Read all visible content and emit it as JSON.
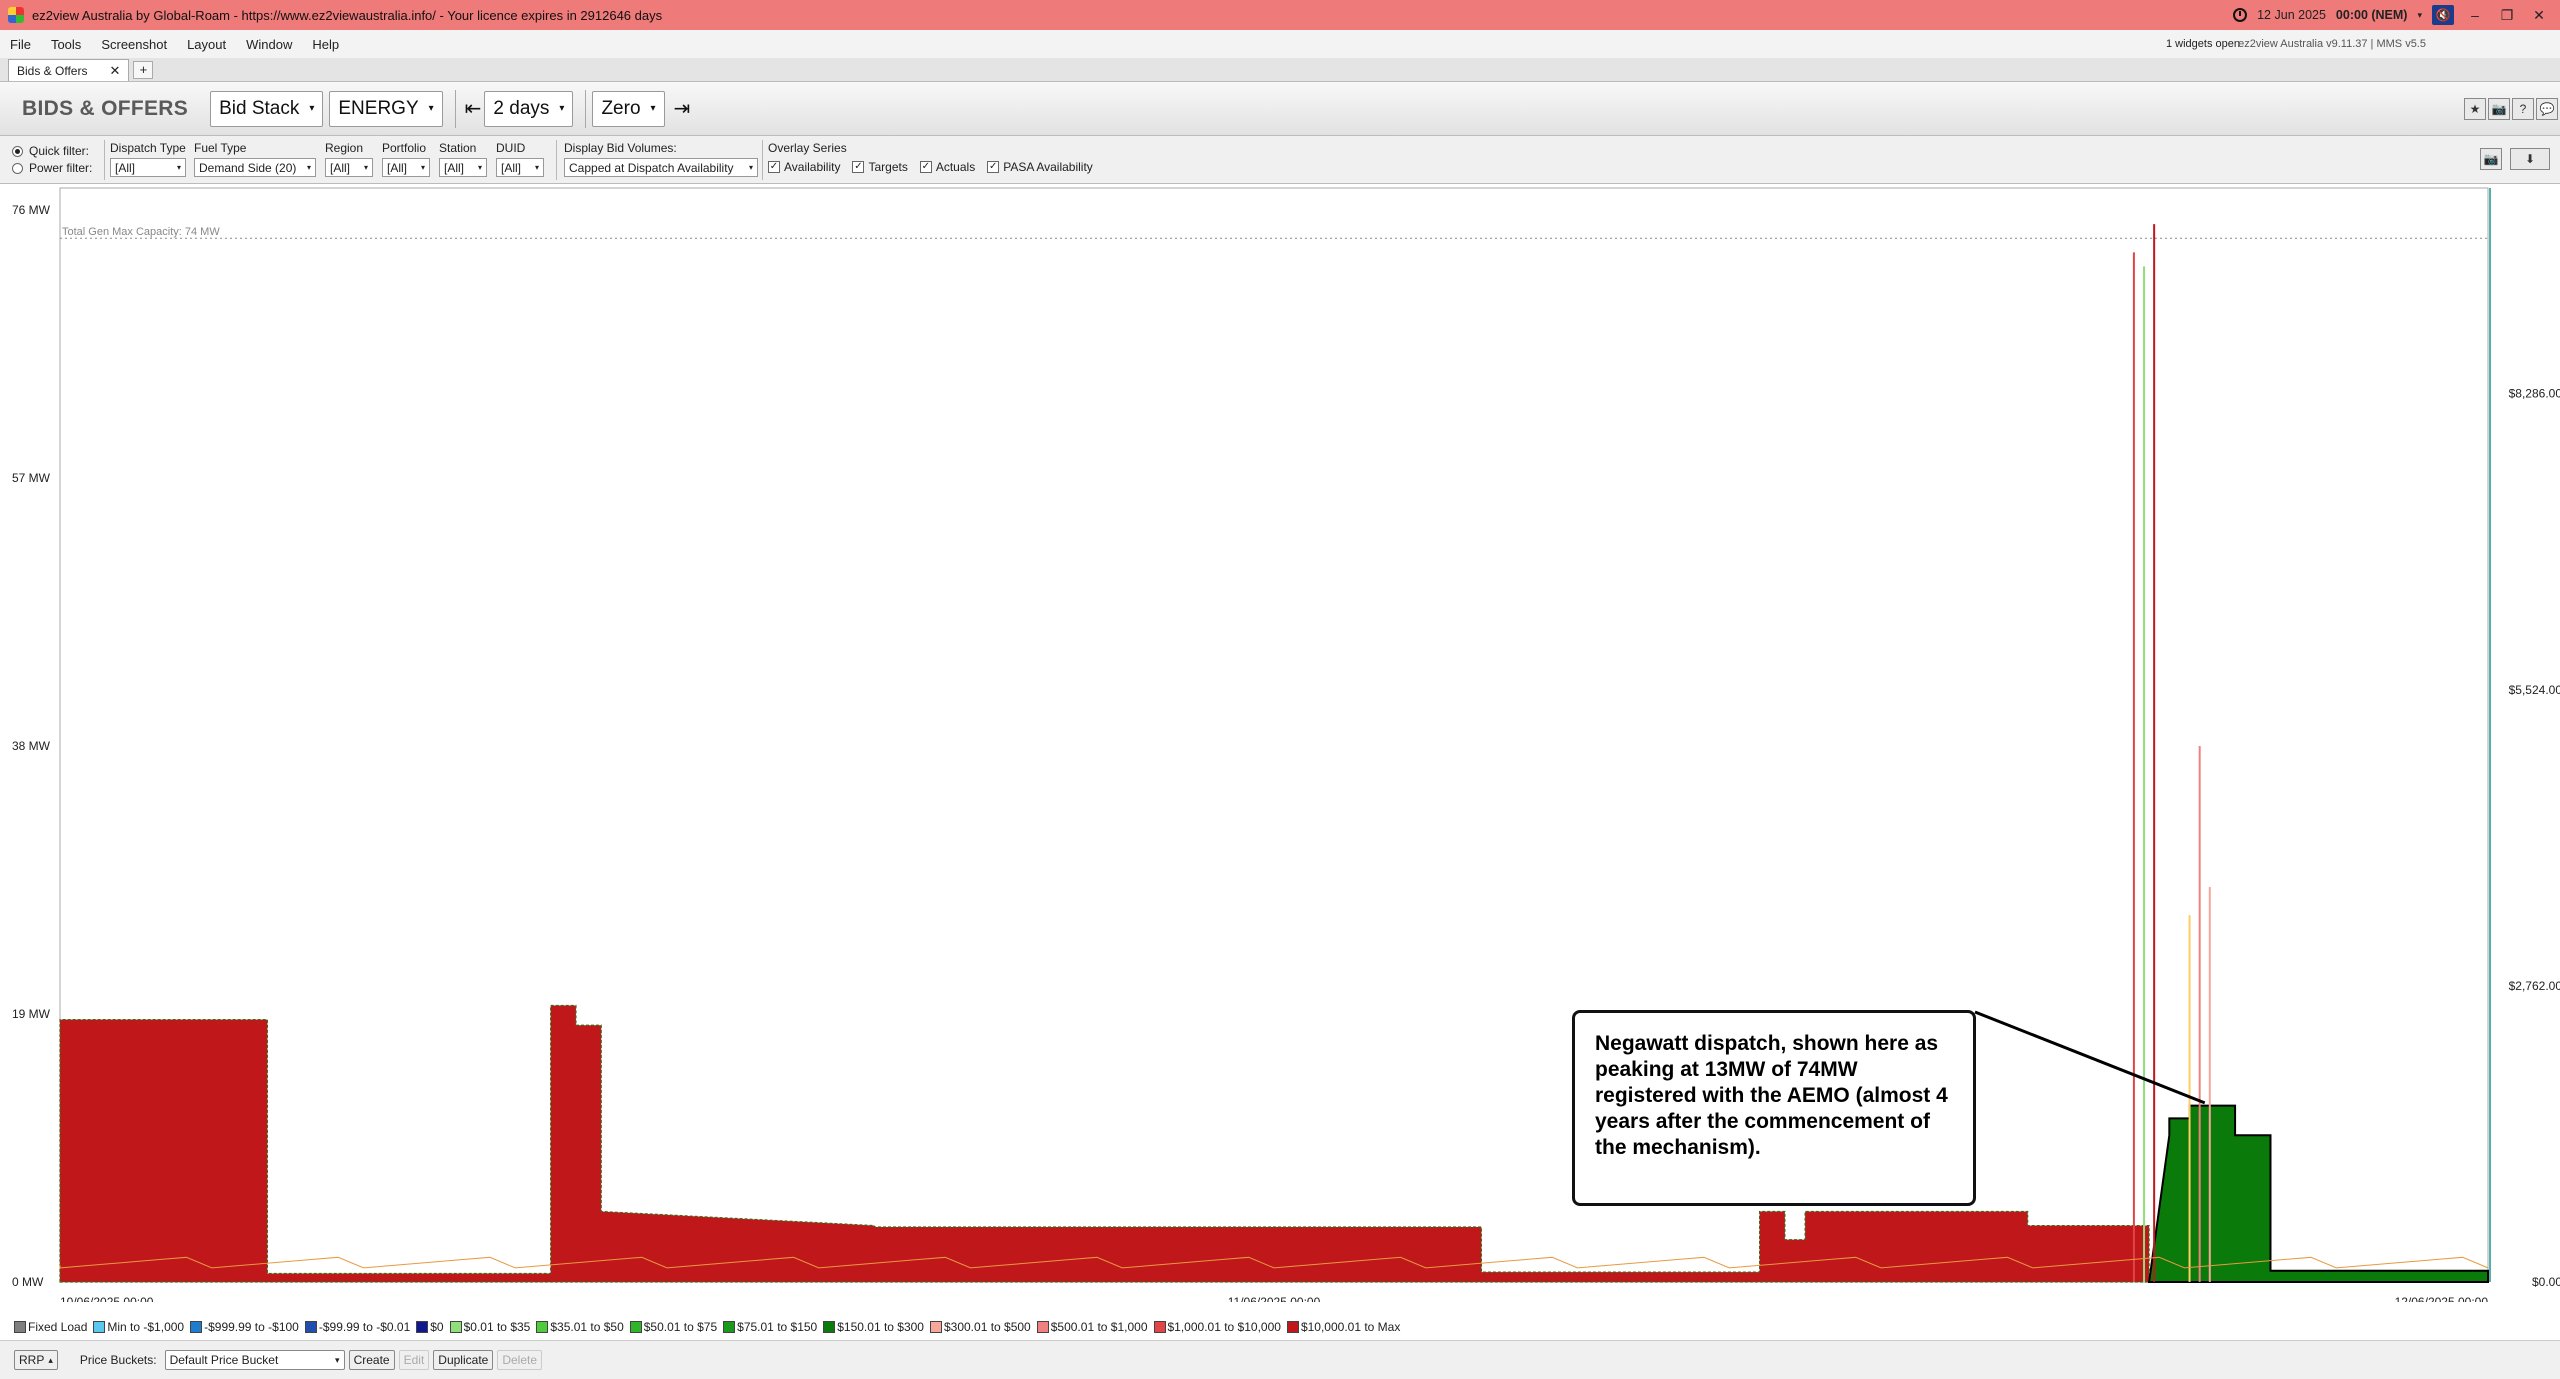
{
  "window": {
    "title": "ez2view Australia by Global-Roam - https://www.ez2viewaustralia.info/ - Your licence expires in 2912646 days",
    "clock": "12 Jun 2025",
    "clock_time": "00:00 (NEM)",
    "mute_glyph": "🔇",
    "min_glyph": "–",
    "restore_glyph": "❐",
    "close_glyph": "✕"
  },
  "menu": {
    "items": [
      "File",
      "Tools",
      "Screenshot",
      "Layout",
      "Window",
      "Help"
    ],
    "widgets_open": "1 widgets open",
    "version_info": "ez2view Australia v9.11.37 | MMS v5.5"
  },
  "tabs": [
    {
      "label": "Bids & Offers",
      "close": "✕"
    }
  ],
  "tab_add": "+",
  "toolbar": {
    "widget_title": "BIDS & OFFERS",
    "view_mode": "Bid Stack",
    "market": "ENERGY",
    "back_glyph": "⇤",
    "period": "2 days",
    "forward_glyph": "⇥",
    "baseline": "Zero",
    "arrow": "▾",
    "icons": [
      "★",
      "📷",
      "?",
      "💬"
    ]
  },
  "filters": {
    "quick_filter": "Quick filter:",
    "power_filter": "Power filter:",
    "dispatch_type": {
      "label": "Dispatch Type",
      "value": "[All]"
    },
    "fuel_type": {
      "label": "Fuel Type",
      "value": "Demand Side (20)"
    },
    "region": {
      "label": "Region",
      "value": "[All]"
    },
    "portfolio": {
      "label": "Portfolio",
      "value": "[All]"
    },
    "station": {
      "label": "Station",
      "value": "[All]"
    },
    "duid": {
      "label": "DUID",
      "value": "[All]"
    },
    "display_bid_volumes": {
      "label": "Display Bid Volumes:",
      "value": "Capped at Dispatch Availability"
    },
    "overlay_series": {
      "label": "Overlay Series",
      "items": [
        "Availability",
        "Targets",
        "Actuals",
        "PASA Availability"
      ],
      "check": "✓"
    },
    "right_icons": [
      "📷",
      "⬇"
    ]
  },
  "chart_data": {
    "type": "area",
    "title": "",
    "capacity_label": "Total Gen Max Capacity: 74 MW",
    "capacity_mw": 74,
    "ylim": [
      0,
      76
    ],
    "yticks": [
      "76 MW",
      "57 MW",
      "38 MW",
      "19 MW",
      "0 MW"
    ],
    "yticks_right": [
      "$8,286.00",
      "$5,524.00",
      "$2,762.00",
      "$0.00"
    ],
    "yticks_right_values": [
      8286,
      5524,
      2762,
      0
    ],
    "y2lim": [
      0,
      10000
    ],
    "xticks": [
      "10/06/2025 00:00",
      "11/06/2025 00:00",
      "12/06/2025 00:00"
    ],
    "x_hours": [
      0,
      48
    ],
    "series": [
      {
        "name": "$10,000.01 to Max",
        "color": "#c0171a",
        "x": [
          0,
          4.1,
          4.1,
          9.7,
          9.7,
          10.2,
          10.2,
          10.7,
          10.7,
          16.1,
          16.1,
          28.1,
          28.1,
          33.6,
          33.6,
          34.1,
          34.1,
          34.5,
          34.5,
          38.9,
          38.9,
          41.3,
          41.3
        ],
        "values": [
          18.6,
          18.6,
          0.6,
          0.6,
          19.6,
          19.6,
          18.2,
          18.2,
          5.0,
          4.0,
          3.9,
          3.9,
          0.7,
          0.7,
          5.0,
          5.0,
          3.0,
          3.0,
          5.0,
          5.0,
          4.0,
          4.0,
          0
        ]
      },
      {
        "name": "$150.01 to $300",
        "color": "#0a7a0a",
        "x": [
          41.3,
          41.7,
          41.7,
          42.1,
          42.1,
          43.0,
          43.0,
          43.7,
          43.7,
          48.0
        ],
        "values": [
          0,
          10.4,
          11.6,
          11.6,
          12.5,
          12.5,
          10.4,
          10.4,
          0.8,
          0.8
        ]
      }
    ],
    "annotation": "Negawatt dispatch, shown here as peaking at 13MW of 74MW registered with the AEMO (almost 4 years after the commencement of the mechanism)."
  },
  "legend": [
    {
      "label": "Fixed Load",
      "color": "#7f7f7f"
    },
    {
      "label": "Min to -$1,000",
      "color": "#5bc8f0"
    },
    {
      "label": "-$999.99 to -$100",
      "color": "#1f7dd0"
    },
    {
      "label": "-$99.99 to -$0.01",
      "color": "#1f4fb0"
    },
    {
      "label": "$0",
      "color": "#101890"
    },
    {
      "label": "$0.01 to $35",
      "color": "#8fe07a"
    },
    {
      "label": "$35.01 to $50",
      "color": "#4fcc3c"
    },
    {
      "label": "$50.01 to $75",
      "color": "#2fb42a"
    },
    {
      "label": "$75.01 to $150",
      "color": "#1a9a1a"
    },
    {
      "label": "$150.01 to $300",
      "color": "#0a7a0a"
    },
    {
      "label": "$300.01 to $500",
      "color": "#f6a79a"
    },
    {
      "label": "$500.01 to $1,000",
      "color": "#f08080"
    },
    {
      "label": "$1,000.01 to $10,000",
      "color": "#e24545"
    },
    {
      "label": "$10,000.01 to Max",
      "color": "#c0171a"
    }
  ],
  "bottom": {
    "rrp_button": "RRP",
    "rrp_arrow": "▴",
    "price_buckets_label": "Price Buckets:",
    "price_bucket_value": "Default Price Bucket",
    "create": "Create",
    "edit": "Edit",
    "duplicate": "Duplicate",
    "delete": "Delete"
  }
}
